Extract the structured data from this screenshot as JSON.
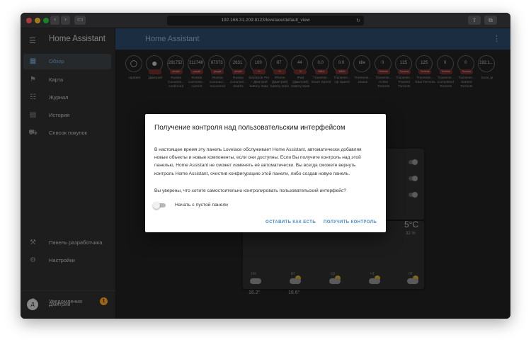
{
  "browser": {
    "url": "192.168.31.209:8123/lovelace/default_view",
    "back_icon": "chevron-left-icon",
    "forward_icon": "chevron-right-icon",
    "sidebar_toggle_icon": "sidebar-icon",
    "reload_icon": "reload-icon",
    "share_icon": "share-icon",
    "tabs_icon": "tabs-icon"
  },
  "sidebar": {
    "title": "Home Assistant",
    "items": [
      {
        "label": "Обзор",
        "icon": "dashboard-icon",
        "active": true
      },
      {
        "label": "Карта",
        "icon": "map-icon",
        "active": false
      },
      {
        "label": "Журнал",
        "icon": "logbook-icon",
        "active": false
      },
      {
        "label": "История",
        "icon": "history-icon",
        "active": false
      },
      {
        "label": "Список покупок",
        "icon": "cart-icon",
        "active": false
      }
    ],
    "bottom_items": [
      {
        "label": "Панель разработчика",
        "icon": "hammer-icon"
      },
      {
        "label": "Настройки",
        "icon": "gear-icon"
      }
    ],
    "notifications": {
      "label": "Уведомления",
      "icon": "bell-icon",
      "count": "1"
    },
    "user": {
      "label": "Дмитрий",
      "initial": "Д"
    }
  },
  "header": {
    "title": "Home Assistant"
  },
  "badges": [
    {
      "value": "",
      "unit": "",
      "label": "Updater"
    },
    {
      "value": "",
      "unit": "",
      "label": "Дмитрий"
    },
    {
      "value": "281752",
      "unit": "people",
      "label": "Russia Coronavi... confirmed"
    },
    {
      "value": "211748",
      "unit": "people",
      "label": "Russia Coronavi... current"
    },
    {
      "value": "67373",
      "unit": "people",
      "label": "Russia Coronavi... recovered"
    },
    {
      "value": "2631",
      "unit": "people",
      "label": "Russia Coronavi... deaths"
    },
    {
      "value": "100",
      "unit": "%",
      "label": "MacBook Pro – Дмитрий battery state"
    },
    {
      "value": "87",
      "unit": "%",
      "label": "iPhone (Дмитрий) battery state"
    },
    {
      "value": "44",
      "unit": "%",
      "label": "iPad (Дмитрий) battery state"
    },
    {
      "value": "0.0",
      "unit": "MiB/s",
      "label": "Transmis... Down Speed"
    },
    {
      "value": "0.0",
      "unit": "MiB/s",
      "label": "Transmis... Up Speed"
    },
    {
      "value": "idle",
      "unit": "",
      "label": "Transmis... Status"
    },
    {
      "value": "0",
      "unit": "Torrents",
      "label": "Transmis... Active Torrents"
    },
    {
      "value": "125",
      "unit": "Torrents",
      "label": "Transmis... Paused Torrents"
    },
    {
      "value": "125",
      "unit": "Torrents",
      "label": "Transmis... Total Torrents"
    },
    {
      "value": "0",
      "unit": "Torrents",
      "label": "Transmis... Completed Torrents"
    },
    {
      "value": "0",
      "unit": "Torrents",
      "label": "Transmis... Started Torrents"
    },
    {
      "value": "192.1...",
      "unit": "",
      "label": "local_ip"
    }
  ],
  "weather": {
    "temp_partial": "5°C",
    "sub_partial": "32 %",
    "days": [
      "пн",
      "вт",
      "ср",
      "чт",
      "пт"
    ],
    "temps": [
      "16.2°",
      "18.6°"
    ]
  },
  "dialog": {
    "title": "Получение контроля над пользовательским интерфейсом",
    "body": "В настоящее время эту панель Lovelace обслуживает Home Assistant, автоматически добавляя новые объекты и новые компоненты, если они доступны. Если Вы получите контроль над этой панелью, Home Assistant не сможет изменять её автоматически. Вы всегда сможете вернуть контроль Home Assistant, очистив конфигурацию этой панели, либо создав новую панель.",
    "question": "Вы уверены, что хотите самостоятельно контролировать пользовательский интерфейс?",
    "switch_label": "Начать с пустой панели",
    "switch_on": false,
    "cancel_label": "ОСТАВИТЬ КАК ЕСТЬ",
    "confirm_label": "ПОЛУЧИТЬ КОНТРОЛЬ"
  }
}
